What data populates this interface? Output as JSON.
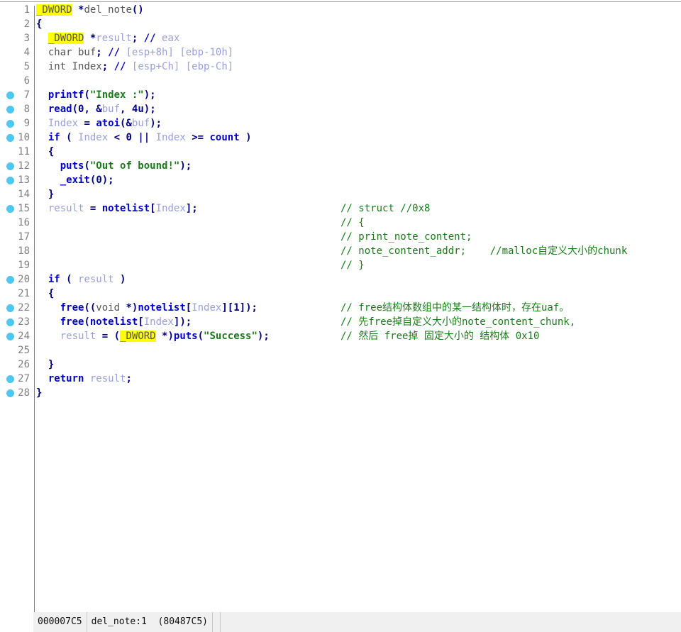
{
  "window": {
    "title": "IDA Pseudocode",
    "view": "pseudocode"
  },
  "editor": {
    "gutter_separator": true,
    "colors": {
      "keyword": "#0000c8",
      "local_var": "#9aa0d8",
      "global_sym": "#0000c8",
      "string": "#1a7a1a",
      "comment_user": "#1a7a1a",
      "comment_auto": "#9aa0d8",
      "number": "#000080",
      "highlight_bg": "#ffff00",
      "breakpoint_dot": "#4ec8f2",
      "line_number": "#808080",
      "background": "#ffffff",
      "status_bar": "#f0f0f0"
    },
    "lines": [
      {
        "n": "1",
        "dot": false,
        "tokens": [
          {
            "t": "_DWORD",
            "c": "hl"
          },
          {
            "t": " *",
            "c": "punct"
          },
          {
            "t": "del_note",
            "c": "plain"
          },
          {
            "t": "()",
            "c": "punct"
          }
        ],
        "comment": ""
      },
      {
        "n": "2",
        "dot": false,
        "tokens": [
          {
            "t": "{",
            "c": "punct"
          }
        ],
        "comment": ""
      },
      {
        "n": "3",
        "dot": false,
        "tokens": [
          {
            "t": "  ",
            "c": "plain"
          },
          {
            "t": "_DWORD",
            "c": "hl"
          },
          {
            "t": " *",
            "c": "punct"
          },
          {
            "t": "result",
            "c": "loc"
          },
          {
            "t": ";",
            "c": "punct"
          },
          {
            "t": " ",
            "c": "plain"
          },
          {
            "t": "//",
            "c": "cmtmark"
          },
          {
            "t": " eax",
            "c": "cmt"
          }
        ],
        "comment": ""
      },
      {
        "n": "4",
        "dot": false,
        "tokens": [
          {
            "t": "  ",
            "c": "plain"
          },
          {
            "t": "char",
            "c": "plain"
          },
          {
            "t": " buf",
            "c": "plain"
          },
          {
            "t": ";",
            "c": "punct"
          },
          {
            "t": " ",
            "c": "plain"
          },
          {
            "t": "//",
            "c": "cmtmark"
          },
          {
            "t": " [esp+8h] [ebp-10h]",
            "c": "cmt"
          }
        ],
        "comment": ""
      },
      {
        "n": "5",
        "dot": false,
        "tokens": [
          {
            "t": "  ",
            "c": "plain"
          },
          {
            "t": "int",
            "c": "plain"
          },
          {
            "t": " Index",
            "c": "plain"
          },
          {
            "t": ";",
            "c": "punct"
          },
          {
            "t": " ",
            "c": "plain"
          },
          {
            "t": "//",
            "c": "cmtmark"
          },
          {
            "t": " [esp+Ch] [ebp-Ch]",
            "c": "cmt"
          }
        ],
        "comment": ""
      },
      {
        "n": "6",
        "dot": false,
        "tokens": [],
        "comment": ""
      },
      {
        "n": "7",
        "dot": true,
        "tokens": [
          {
            "t": "  ",
            "c": "plain"
          },
          {
            "t": "printf",
            "c": "func"
          },
          {
            "t": "(",
            "c": "punct"
          },
          {
            "t": "\"Index :\"",
            "c": "str"
          },
          {
            "t": ");",
            "c": "punct"
          }
        ],
        "comment": ""
      },
      {
        "n": "8",
        "dot": true,
        "tokens": [
          {
            "t": "  ",
            "c": "plain"
          },
          {
            "t": "read",
            "c": "func"
          },
          {
            "t": "(",
            "c": "punct"
          },
          {
            "t": "0",
            "c": "num"
          },
          {
            "t": ", &",
            "c": "punct"
          },
          {
            "t": "buf",
            "c": "loc"
          },
          {
            "t": ", ",
            "c": "punct"
          },
          {
            "t": "4u",
            "c": "num"
          },
          {
            "t": ");",
            "c": "punct"
          }
        ],
        "comment": ""
      },
      {
        "n": "9",
        "dot": true,
        "tokens": [
          {
            "t": "  ",
            "c": "plain"
          },
          {
            "t": "Index",
            "c": "loc"
          },
          {
            "t": " = ",
            "c": "punct"
          },
          {
            "t": "atoi",
            "c": "func"
          },
          {
            "t": "(&",
            "c": "punct"
          },
          {
            "t": "buf",
            "c": "loc"
          },
          {
            "t": ");",
            "c": "punct"
          }
        ],
        "comment": ""
      },
      {
        "n": "10",
        "dot": true,
        "tokens": [
          {
            "t": "  ",
            "c": "plain"
          },
          {
            "t": "if",
            "c": "kw"
          },
          {
            "t": " ( ",
            "c": "punct"
          },
          {
            "t": "Index",
            "c": "loc"
          },
          {
            "t": " < ",
            "c": "punct"
          },
          {
            "t": "0",
            "c": "num"
          },
          {
            "t": " || ",
            "c": "punct"
          },
          {
            "t": "Index",
            "c": "loc"
          },
          {
            "t": " >= ",
            "c": "punct"
          },
          {
            "t": "count",
            "c": "glob"
          },
          {
            "t": " )",
            "c": "punct"
          }
        ],
        "comment": ""
      },
      {
        "n": "11",
        "dot": false,
        "tokens": [
          {
            "t": "  ",
            "c": "plain"
          },
          {
            "t": "{",
            "c": "punct"
          }
        ],
        "comment": ""
      },
      {
        "n": "12",
        "dot": true,
        "tokens": [
          {
            "t": "    ",
            "c": "plain"
          },
          {
            "t": "puts",
            "c": "func"
          },
          {
            "t": "(",
            "c": "punct"
          },
          {
            "t": "\"Out of bound!\"",
            "c": "str"
          },
          {
            "t": ");",
            "c": "punct"
          }
        ],
        "comment": ""
      },
      {
        "n": "13",
        "dot": true,
        "tokens": [
          {
            "t": "    ",
            "c": "plain"
          },
          {
            "t": "_exit",
            "c": "func"
          },
          {
            "t": "(",
            "c": "punct"
          },
          {
            "t": "0",
            "c": "num"
          },
          {
            "t": ");",
            "c": "punct"
          }
        ],
        "comment": ""
      },
      {
        "n": "14",
        "dot": false,
        "tokens": [
          {
            "t": "  ",
            "c": "plain"
          },
          {
            "t": "}",
            "c": "punct"
          }
        ],
        "comment": ""
      },
      {
        "n": "15",
        "dot": true,
        "tokens": [
          {
            "t": "  ",
            "c": "plain"
          },
          {
            "t": "result",
            "c": "loc"
          },
          {
            "t": " = ",
            "c": "punct"
          },
          {
            "t": "notelist",
            "c": "glob"
          },
          {
            "t": "[",
            "c": "punct"
          },
          {
            "t": "Index",
            "c": "loc"
          },
          {
            "t": "];",
            "c": "punct"
          }
        ],
        "comment": "// struct //0x8"
      },
      {
        "n": "16",
        "dot": false,
        "tokens": [],
        "comment": "// {"
      },
      {
        "n": "17",
        "dot": false,
        "tokens": [],
        "comment": "// print_note_content;"
      },
      {
        "n": "18",
        "dot": false,
        "tokens": [],
        "comment": "// note_content_addr;    //malloc自定义大小的chunk"
      },
      {
        "n": "19",
        "dot": false,
        "tokens": [],
        "comment": "// }"
      },
      {
        "n": "20",
        "dot": true,
        "tokens": [
          {
            "t": "  ",
            "c": "plain"
          },
          {
            "t": "if",
            "c": "kw"
          },
          {
            "t": " ( ",
            "c": "punct"
          },
          {
            "t": "result",
            "c": "loc"
          },
          {
            "t": " )",
            "c": "punct"
          }
        ],
        "comment": ""
      },
      {
        "n": "21",
        "dot": false,
        "tokens": [
          {
            "t": "  ",
            "c": "plain"
          },
          {
            "t": "{",
            "c": "punct"
          }
        ],
        "comment": ""
      },
      {
        "n": "22",
        "dot": true,
        "tokens": [
          {
            "t": "    ",
            "c": "plain"
          },
          {
            "t": "free",
            "c": "func"
          },
          {
            "t": "((",
            "c": "punct"
          },
          {
            "t": "void",
            "c": "plain"
          },
          {
            "t": " *)",
            "c": "punct"
          },
          {
            "t": "notelist",
            "c": "glob"
          },
          {
            "t": "[",
            "c": "punct"
          },
          {
            "t": "Index",
            "c": "loc"
          },
          {
            "t": "][",
            "c": "punct"
          },
          {
            "t": "1",
            "c": "num"
          },
          {
            "t": "]);",
            "c": "punct"
          }
        ],
        "comment": "// free结构体数组中的某一结构体时，存在uaf。"
      },
      {
        "n": "23",
        "dot": true,
        "tokens": [
          {
            "t": "    ",
            "c": "plain"
          },
          {
            "t": "free",
            "c": "func"
          },
          {
            "t": "(",
            "c": "punct"
          },
          {
            "t": "notelist",
            "c": "glob"
          },
          {
            "t": "[",
            "c": "punct"
          },
          {
            "t": "Index",
            "c": "loc"
          },
          {
            "t": "]);",
            "c": "punct"
          }
        ],
        "comment": "// 先free掉自定义大小的note_content_chunk,"
      },
      {
        "n": "24",
        "dot": true,
        "tokens": [
          {
            "t": "    ",
            "c": "plain"
          },
          {
            "t": "result",
            "c": "loc"
          },
          {
            "t": " = (",
            "c": "punct"
          },
          {
            "t": "_DWORD",
            "c": "hl"
          },
          {
            "t": " *)",
            "c": "punct"
          },
          {
            "t": "puts",
            "c": "func"
          },
          {
            "t": "(",
            "c": "punct"
          },
          {
            "t": "\"Success\"",
            "c": "str"
          },
          {
            "t": ");",
            "c": "punct"
          }
        ],
        "comment": "// 然后 free掉 固定大小的 结构体 0x10"
      },
      {
        "n": "25",
        "dot": false,
        "tokens": [],
        "comment": ""
      },
      {
        "n": "26",
        "dot": false,
        "tokens": [
          {
            "t": "  ",
            "c": "plain"
          },
          {
            "t": "}",
            "c": "punct"
          }
        ],
        "comment": ""
      },
      {
        "n": "27",
        "dot": true,
        "tokens": [
          {
            "t": "  ",
            "c": "plain"
          },
          {
            "t": "return",
            "c": "kw"
          },
          {
            "t": " ",
            "c": "plain"
          },
          {
            "t": "result",
            "c": "loc"
          },
          {
            "t": ";",
            "c": "punct"
          }
        ],
        "comment": ""
      },
      {
        "n": "28",
        "dot": true,
        "tokens": [
          {
            "t": "}",
            "c": "punct"
          }
        ],
        "comment": ""
      }
    ]
  },
  "status_bar": {
    "offset": "000007C5",
    "location": "del_note:1  (80487C5)"
  }
}
